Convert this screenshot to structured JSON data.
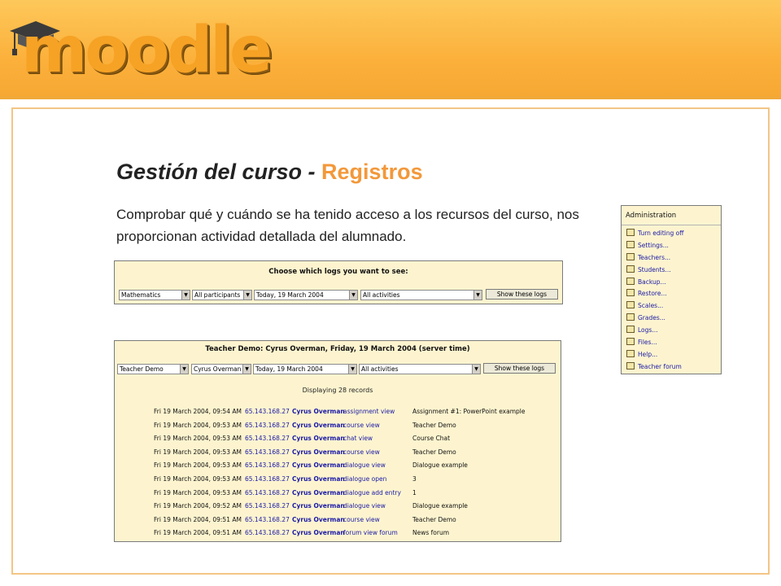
{
  "logo": {
    "text": "moodle",
    "icon": "graduation-cap-icon"
  },
  "title": {
    "main": "Gestión del curso - ",
    "accent": "Registros"
  },
  "description": "Comprobar qué y cuándo se ha tenido acceso a los recursos del curso, nos proporcionan actividad detallada del alumnado.",
  "panel1": {
    "heading": "Choose which logs you want to see:",
    "course": "Mathematics",
    "participants": "All participants",
    "date": "Today, 19 March 2004",
    "activities": "All activities",
    "button": "Show these logs"
  },
  "panel2": {
    "heading": "Teacher Demo: Cyrus Overman, Friday, 19 March 2004 (server time)",
    "course": "Teacher Demo",
    "user": "Cyrus Overman",
    "date": "Today, 19 March 2004",
    "activities": "All activities",
    "button": "Show these logs",
    "records": "Displaying 28 records",
    "rows": [
      {
        "date": "Fri  19 March 2004, 09:54 AM",
        "ip": "65.143.168.27",
        "user": "Cyrus Overman",
        "action": "assignment view",
        "info": "Assignment #1: PowerPoint example"
      },
      {
        "date": "Fri  19 March 2004, 09:53 AM",
        "ip": "65.143.168.27",
        "user": "Cyrus Overman",
        "action": "course view",
        "info": "Teacher Demo"
      },
      {
        "date": "Fri  19 March 2004, 09:53 AM",
        "ip": "65.143.168.27",
        "user": "Cyrus Overman",
        "action": "chat view",
        "info": "Course Chat"
      },
      {
        "date": "Fri  19 March 2004, 09:53 AM",
        "ip": "65.143.168.27",
        "user": "Cyrus Overman",
        "action": "course view",
        "info": "Teacher Demo"
      },
      {
        "date": "Fri  19 March 2004, 09:53 AM",
        "ip": "65.143.168.27",
        "user": "Cyrus Overman",
        "action": "dialogue view",
        "info": "Dialogue example"
      },
      {
        "date": "Fri  19 March 2004, 09:53 AM",
        "ip": "65.143.168.27",
        "user": "Cyrus Overman",
        "action": "dialogue open",
        "info": "3"
      },
      {
        "date": "Fri  19 March 2004, 09:53 AM",
        "ip": "65.143.168.27",
        "user": "Cyrus Overman",
        "action": "dialogue add entry",
        "info": "1"
      },
      {
        "date": "Fri  19 March 2004, 09:52 AM",
        "ip": "65.143.168.27",
        "user": "Cyrus Overman",
        "action": "dialogue view",
        "info": "Dialogue example"
      },
      {
        "date": "Fri  19 March 2004, 09:51 AM",
        "ip": "65.143.168.27",
        "user": "Cyrus Overman",
        "action": "course view",
        "info": "Teacher Demo"
      },
      {
        "date": "Fri  19 March 2004, 09:51 AM",
        "ip": "65.143.168.27",
        "user": "Cyrus Overman",
        "action": "forum view forum",
        "info": "News forum"
      }
    ]
  },
  "admin": {
    "heading": "Administration",
    "items": [
      {
        "label": "Turn editing off",
        "icon": "edit-icon"
      },
      {
        "label": "Settings...",
        "icon": "settings-icon"
      },
      {
        "label": "Teachers...",
        "icon": "teachers-icon"
      },
      {
        "label": "Students...",
        "icon": "students-icon"
      },
      {
        "label": "Backup...",
        "icon": "backup-icon"
      },
      {
        "label": "Restore...",
        "icon": "restore-icon"
      },
      {
        "label": "Scales...",
        "icon": "scales-icon"
      },
      {
        "label": "Grades...",
        "icon": "grades-icon"
      },
      {
        "label": "Logs...",
        "icon": "logs-icon"
      },
      {
        "label": "Files...",
        "icon": "folder-icon"
      },
      {
        "label": "Help...",
        "icon": "help-icon"
      },
      {
        "label": "Teacher forum",
        "icon": "forum-icon"
      }
    ]
  }
}
